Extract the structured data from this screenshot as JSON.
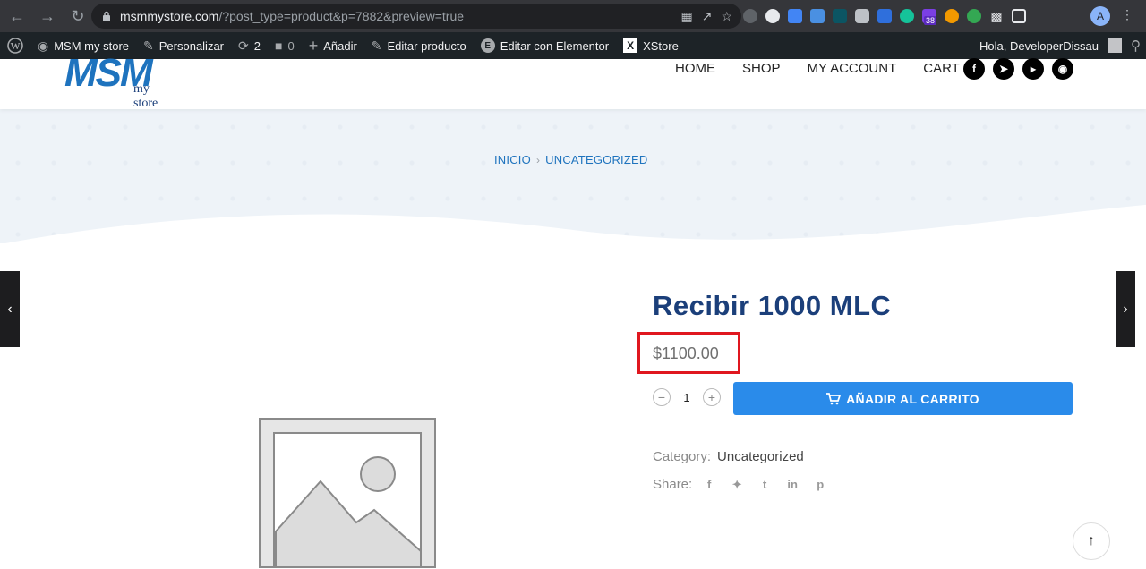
{
  "browser": {
    "url_host": "msmmystore.com",
    "url_path": "/?post_type=product&p=7882&preview=true",
    "profile_initial": "A",
    "ext_badge": "38"
  },
  "wp_bar": {
    "site": "MSM my store",
    "customize": "Personalizar",
    "updates_count": "2",
    "comments_count": "0",
    "add_new": "Añadir",
    "edit_product": "Editar producto",
    "edit_elementor": "Editar con Elementor",
    "xstore": "XStore",
    "greeting": "Hola, DeveloperDissau"
  },
  "header": {
    "logo_main": "MSM",
    "logo_sub": "my store",
    "nav": [
      "HOME",
      "SHOP",
      "MY ACCOUNT",
      "CART"
    ],
    "social": [
      "facebook-icon",
      "telegram-icon",
      "youtube-icon",
      "instagram-icon"
    ]
  },
  "breadcrumb": {
    "home": "INICIO",
    "category": "UNCATEGORIZED"
  },
  "product": {
    "title": "Recibir 1000 MLC",
    "price": "$1100.00",
    "quantity": "1",
    "add_to_cart": "AÑADIR AL CARRITO",
    "category_label": "Category:",
    "category_value": "Uncategorized",
    "share_label": "Share:",
    "share_icons": [
      "facebook-icon",
      "twitter-icon",
      "tumblr-icon",
      "linkedin-icon",
      "pinterest-icon"
    ]
  },
  "colors": {
    "accent": "#2a8bea",
    "title": "#1b3f7a",
    "highlight": "#e0171f"
  }
}
